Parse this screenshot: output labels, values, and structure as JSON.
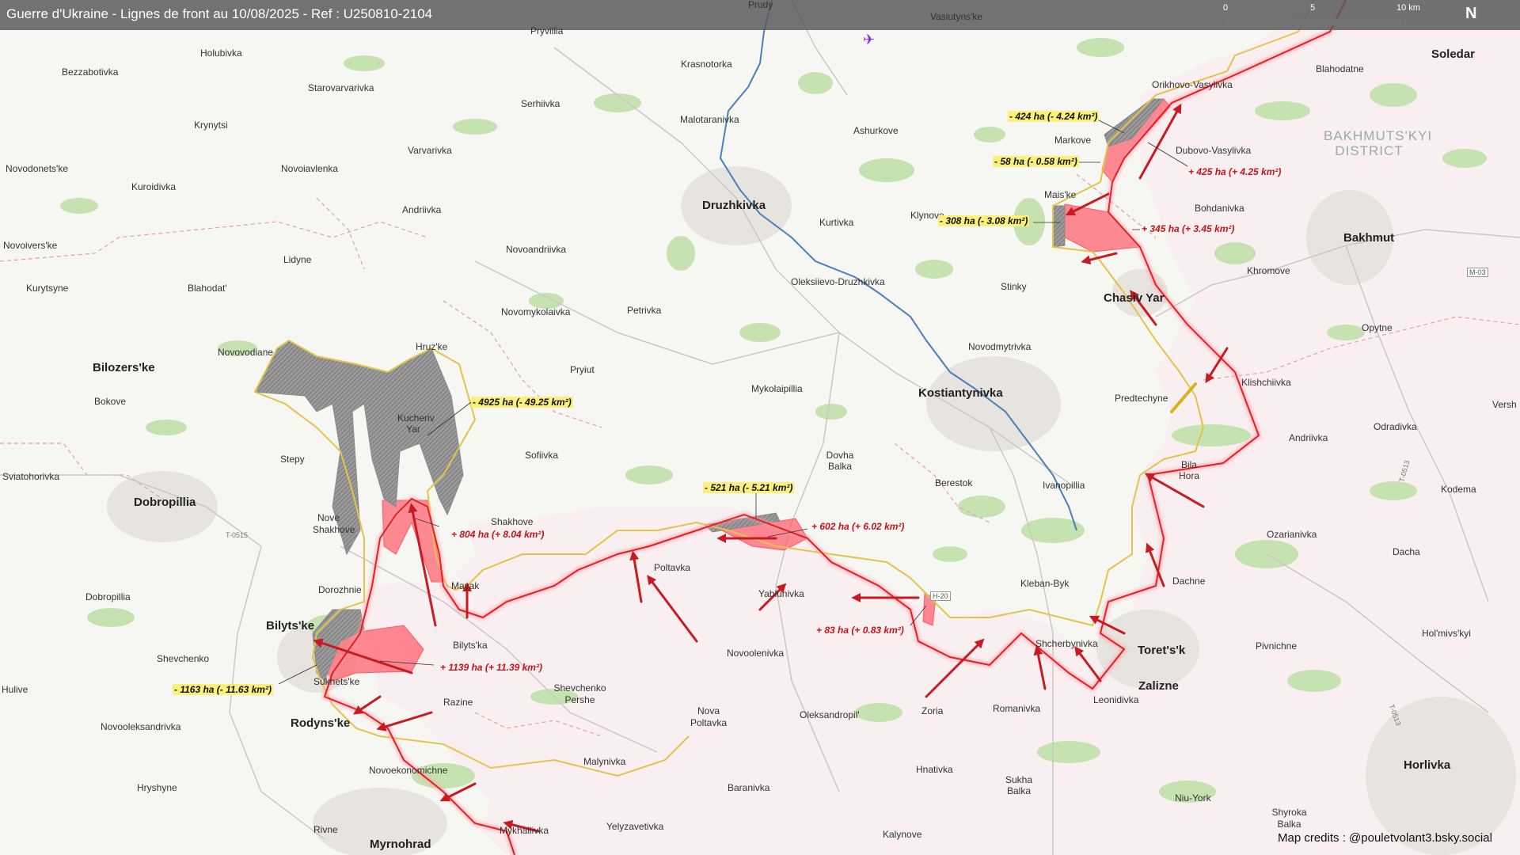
{
  "header": {
    "title": "Guerre d'Ukraine - Lignes de front au 10/08/2025 - Ref : U250810-2104",
    "scale_labels": [
      "0",
      "5",
      "10 km"
    ],
    "north_label": "N"
  },
  "credits": "Map credits : @pouletvolant3.bsky.social",
  "place_labels": {
    "prudy": "Prudy",
    "pryvillia": "Pryvillia",
    "vasiutyns_ke": "Vasiutyns'ke",
    "holubivka": "Holubivka",
    "bezzabotivka": "Bezzabotivka",
    "krasnotorka": "Krasnotorka",
    "orikhovo_vasylivka": "Orikhovo-Vasylivka",
    "blahodatne": "Blahodatne",
    "soledar": "Soledar",
    "starovarvarivka": "Starovarvarivka",
    "serhiivka": "Serhiivka",
    "malotaranivka": "Malotaranivka",
    "krynytsi": "Krynytsi",
    "ashurkove": "Ashurkove",
    "markove": "Markove",
    "dubovo_vasylivka": "Dubovo-Vasylivka",
    "varvarivka": "Varvarivka",
    "novodonets_ke": "Novodonets'ke",
    "novoiavlenka": "Novoiavlenka",
    "kuroidivka": "Kuroidivka",
    "druzhkivka": "Druzhkivka",
    "mais_ke": "Mais'ke",
    "bohdanivka": "Bohdanivka",
    "andriivka": "Andriivka",
    "klynove": "Klynove",
    "kurtivka": "Kurtivka",
    "bakhmut": "Bakhmut",
    "novoivers_ke": "Novoivers'ke",
    "lidyne": "Lidyne",
    "novoandriivka": "Novoandriivka",
    "khromove": "Khromove",
    "kurytsyne": "Kurytsyne",
    "blahodat": "Blahodat'",
    "novomykolaivka": "Novomykolaivka",
    "petrivka": "Petrivka",
    "oleksiievo_druzhkivka": "Oleksiievo-Druzhkivka",
    "stinky": "Stinky",
    "chasiv_yar": "Chasiv Yar",
    "opytne": "Opytne",
    "novovodiane": "Novovodiane",
    "hruz_ke": "Hruz'ke",
    "pryiut": "Pryiut",
    "novodmytrivka": "Novodmytrivka",
    "bilozers_ke": "Bilozers'ke",
    "klishchiivka": "Klishchiivka",
    "bokove": "Bokove",
    "mykolaipillia": "Mykolaipillia",
    "kostiantynivka": "Kostiantynivka",
    "predtechyne": "Predtechyne",
    "kucheriv_yar": "Kucheriv Yar",
    "odradivka": "Odradivka",
    "versh": "Versh",
    "andriivka_e": "Andriivka",
    "stepy": "Stepy",
    "sofiivka": "Sofiivka",
    "dovha_balka": "Dovha Balka",
    "bila_hora": "Bila Hora",
    "sviatohorivka": "Sviatohorivka",
    "dobropillia": "Dobropillia",
    "berestok": "Berestok",
    "ivanopillia": "Ivanopillia",
    "kodema": "Kodema",
    "nove_shakhove": "Nove Shakhove",
    "shakhove": "Shakhove",
    "ozarianivka": "Ozarianivka",
    "poltavka": "Poltavka",
    "dacha": "Dacha",
    "dobropillia_s": "Dobropillia",
    "dorozhnie": "Dorozhnie",
    "mayak": "Mayak",
    "dachne": "Dachne",
    "kleban_byk": "Kleban-Byk",
    "yablunivka": "Yablunivka",
    "bilyts_ke": "Bilyts'ke",
    "shcherbynivka": "Shcherbynivka",
    "pivnichne": "Pivnichne",
    "hol_mivs_kyi": "Hol'mivs'kyi",
    "toret_sk": "Toret's'k",
    "shevchenko": "Shevchenko",
    "bilyts_ka": "Bilyts'ka",
    "novoolenivka": "Novoolenivka",
    "zalizne": "Zalizne",
    "hulive": "Hulive",
    "sukhets_ke": "Sukhets'ke",
    "shevchenko_pershe": "Shevchenko Pershe",
    "leonidivka": "Leonidivka",
    "razine": "Razine",
    "novooleksandrivka": "Novooleksandrivka",
    "nova_poltavka": "Nova Poltavka",
    "oleksandropil": "Oleksandropil'",
    "zoria": "Zoria",
    "romanivka": "Romanivka",
    "rodyns_ke": "Rodyns'ke",
    "malynivka": "Malynivka",
    "novoekonomichne": "Novoekonomichne",
    "hnativka": "Hnativka",
    "horlivka": "Horlivka",
    "hryshyne": "Hryshyne",
    "baranivka": "Baranivka",
    "sukha_balka": "Sukha Balka",
    "niu_york": "Niu-York",
    "shyroka_balka": "Shyroka Balka",
    "rivne": "Rivne",
    "mykhailivka": "Mykhailivka",
    "yelyzavetivka": "Yelyzavetivka",
    "kalynove": "Kalynove",
    "myrnohrad": "Myrnohrad",
    "bakhmuts_kyi_district": "BAKHMUTS'KYI DISTRICT"
  },
  "road_labels": {
    "m03": "M-03",
    "t0515": "T-0515",
    "t0513": "T-0513",
    "t0513b": "T-0513",
    "h20": "H-20"
  },
  "annotations": {
    "losses": [
      "- 424 ha (- 4.24 km²)",
      "- 58 ha (- 0.58 km²)",
      "- 308 ha (- 3.08 km²)",
      "- 4925 ha (- 49.25 km²)",
      "- 521 ha (- 5.21 km²)",
      "- 1163 ha (- 11.63 km²)"
    ],
    "gains": [
      "+ 425 ha (+ 4.25 km²)",
      "+ 345 ha (+ 3.45 km²)",
      "+ 804 ha (+ 8.04 km²)",
      "+ 602 ha (+ 6.02 km²)",
      "+ 83 ha (+ 0.83 km²)",
      "+ 1139 ha (+ 11.39 km²)"
    ]
  },
  "colors": {
    "header_bg": "#5a5a5a",
    "frontline_red": "#e81e25",
    "frontline_yellow": "#e3c44a",
    "gain_fill": "#ff5a66",
    "loss_fill": "#8c8c8c",
    "label_yellow": "#fbf07a",
    "gain_text": "#c4141a",
    "river": "#4a7fbf",
    "forest": "#b9dca3",
    "urban": "#e6e2dc"
  }
}
